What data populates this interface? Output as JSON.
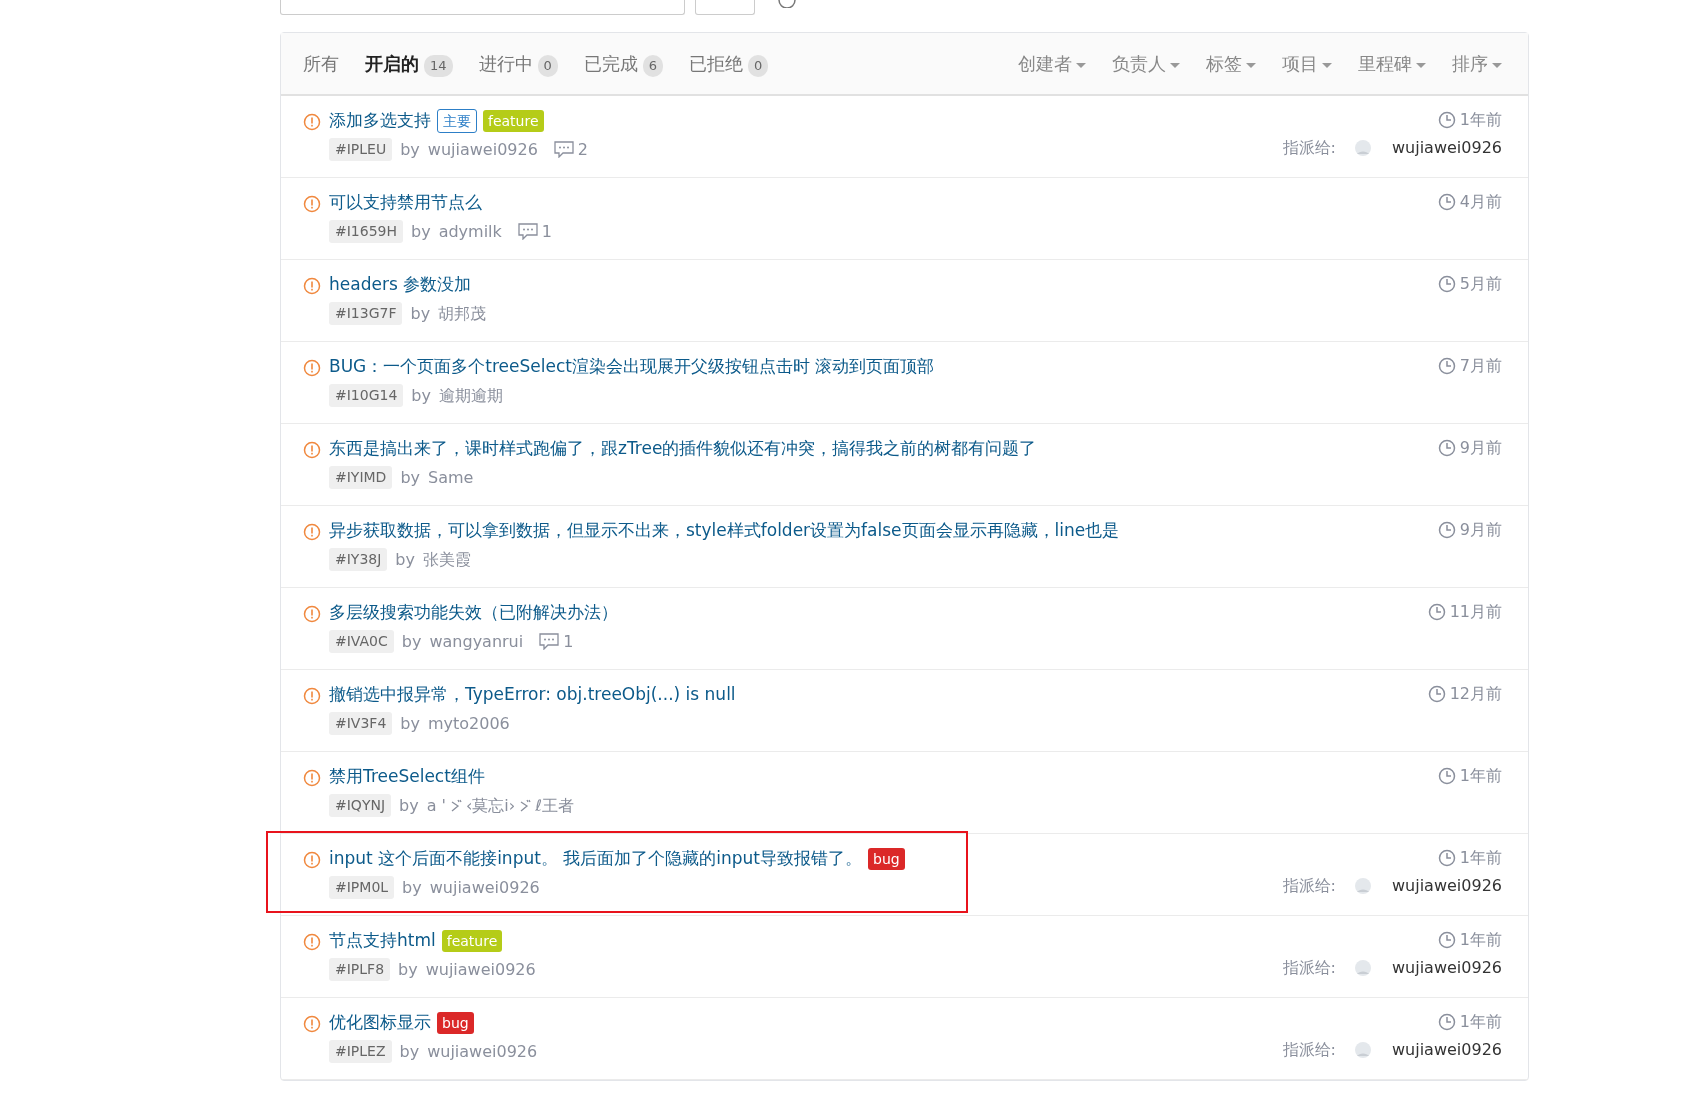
{
  "tabs": [
    {
      "label": "所有",
      "selected": false
    },
    {
      "label": "开启的",
      "count": "14",
      "selected": true
    },
    {
      "label": "进行中",
      "count": "0",
      "selected": false
    },
    {
      "label": "已完成",
      "count": "6",
      "selected": false
    },
    {
      "label": "已拒绝",
      "count": "0",
      "selected": false
    }
  ],
  "filters": [
    "创建者",
    "负责人",
    "标签",
    "项目",
    "里程碑",
    "排序"
  ],
  "issues": [
    {
      "title": "添加多选支持",
      "labels": [
        {
          "text": "主要",
          "kind": "outline",
          "color": "#2d7fc7"
        },
        {
          "text": "feature",
          "kind": "filled",
          "color": "#b5cc18"
        }
      ],
      "id": "#IPLEU",
      "by": "by",
      "author": "wujiawei0926",
      "comments": "2",
      "time": "1年前",
      "assignee_label": "指派给:",
      "assignee": "wujiawei0926",
      "highlighted": false
    },
    {
      "title": "可以支持禁用节点么",
      "id": "#I1659H",
      "by": "by",
      "author": "adymilk",
      "comments": "1",
      "time": "4月前",
      "highlighted": false
    },
    {
      "title": "headers 参数没加",
      "id": "#I13G7F",
      "by": "by",
      "author": "胡邦茂",
      "time": "5月前",
      "highlighted": false
    },
    {
      "title": "BUG：一个页面多个treeSelect渲染会出现展开父级按钮点击时 滚动到页面顶部",
      "id": "#I10G14",
      "by": "by",
      "author": "逾期逾期",
      "time": "7月前",
      "highlighted": false
    },
    {
      "title": "东西是搞出来了，课时样式跑偏了，跟zTree的插件貌似还有冲突，搞得我之前的树都有问题了",
      "id": "#IYIMD",
      "by": "by",
      "author": "Same",
      "time": "9月前",
      "highlighted": false
    },
    {
      "title": "异步获取数据，可以拿到数据，但显示不出来，style样式folder设置为false页面会显示再隐藏，line也是",
      "id": "#IY38J",
      "by": "by",
      "author": "张美霞",
      "time": "9月前",
      "highlighted": false
    },
    {
      "title": "多层级搜索功能失效（已附解决办法）",
      "id": "#IVA0C",
      "by": "by",
      "author": "wangyanrui",
      "comments": "1",
      "time": "11月前",
      "highlighted": false
    },
    {
      "title": "撤销选中报异常，TypeError: obj.treeObj(...) is null",
      "id": "#IV3F4",
      "by": "by",
      "author": "myto2006",
      "time": "12月前",
      "highlighted": false
    },
    {
      "title": "禁用TreeSelect组件",
      "id": "#IQYNJ",
      "by": "by",
      "author_parts": [
        {
          "kind": "text",
          "text": "a '"
        },
        {
          "kind": "mark"
        },
        {
          "kind": "text",
          "text": "‹莫忘i›"
        },
        {
          "kind": "mark"
        },
        {
          "kind": "text",
          "text": "ℓ王者"
        }
      ],
      "time": "1年前",
      "highlighted": false
    },
    {
      "title": "input 这个后面不能接input。 我后面加了个隐藏的input导致报错了。",
      "labels": [
        {
          "text": "bug",
          "kind": "filled",
          "color": "#db2828"
        }
      ],
      "id": "#IPM0L",
      "by": "by",
      "author": "wujiawei0926",
      "time": "1年前",
      "assignee_label": "指派给:",
      "assignee": "wujiawei0926",
      "highlighted": true
    },
    {
      "title": "节点支持html",
      "labels": [
        {
          "text": "feature",
          "kind": "filled",
          "color": "#b5cc18"
        }
      ],
      "id": "#IPLF8",
      "by": "by",
      "author": "wujiawei0926",
      "time": "1年前",
      "assignee_label": "指派给:",
      "assignee": "wujiawei0926",
      "highlighted": false
    },
    {
      "title": "优化图标显示",
      "labels": [
        {
          "text": "bug",
          "kind": "filled",
          "color": "#db2828"
        }
      ],
      "id": "#IPLEZ",
      "by": "by",
      "author": "wujiawei0926",
      "time": "1年前",
      "assignee_label": "指派给:",
      "assignee": "wujiawei0926",
      "highlighted": false
    }
  ]
}
